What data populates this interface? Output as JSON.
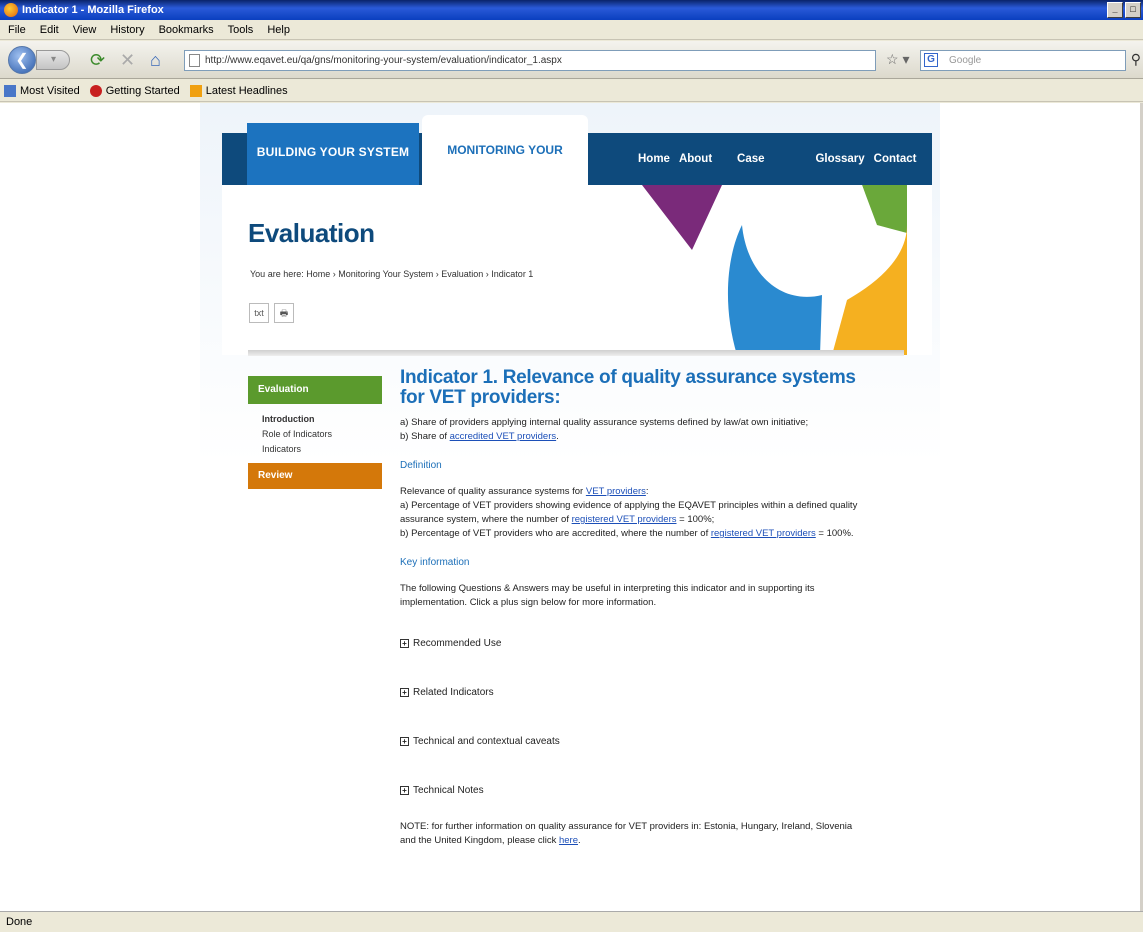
{
  "browser": {
    "title": "Indicator 1 - Mozilla Firefox",
    "window_controls": [
      "_",
      "□"
    ],
    "menu": [
      "File",
      "Edit",
      "View",
      "History",
      "Bookmarks",
      "Tools",
      "Help"
    ],
    "url": "http://www.eqavet.eu/qa/gns/monitoring-your-system/evaluation/indicator_1.aspx",
    "search_placeholder": "Google",
    "search_engine_icon": "G",
    "bookmarks": [
      {
        "label": "Most Visited",
        "icon": "page-icon",
        "color": "#4a78c8"
      },
      {
        "label": "Getting Started",
        "icon": "firefox-icon",
        "color": "#c82020"
      },
      {
        "label": "Latest Headlines",
        "icon": "rss-icon",
        "color": "#f0a010"
      }
    ],
    "status": "Done"
  },
  "site": {
    "tab_building": "BUILDING YOUR SYSTEM",
    "tab_monitoring": "MONITORING YOUR SYSTEM",
    "top_links": [
      "Home",
      "About Us",
      "Case Studies",
      "Glossary",
      "Contact Us"
    ],
    "page_title": "Evaluation",
    "breadcrumb": "You are here: Home › Monitoring Your System › Evaluation › Indicator 1",
    "tools": [
      "txt",
      "🖶"
    ],
    "colors": {
      "navy": "#0e4a7c",
      "blue": "#1c73bf",
      "green": "#5b9a2d",
      "orange": "#d4780a",
      "purple": "#7a2a7a",
      "yellow": "#f5b020"
    }
  },
  "sidenav": {
    "heading": "Evaluation",
    "items": [
      "Introduction",
      "Role of Indicators",
      "Indicators"
    ],
    "orange_item": "Review"
  },
  "main": {
    "title": "Indicator 1. Relevance of quality assurance systems for VET providers:",
    "intro_a": "a) Share of providers applying internal quality assurance systems defined by law/at own initiative;",
    "intro_b_prefix": "b) Share of ",
    "intro_b_link": "accredited VET providers",
    "intro_b_suffix": ".",
    "definition_head": "Definition",
    "def_line1_prefix": "Relevance of quality assurance systems for ",
    "def_line1_link": "VET providers",
    "def_line1_suffix": ":",
    "def_a_prefix": "a) Percentage of VET providers showing evidence of applying the EQAVET principles within a defined quality assurance system, where the number of ",
    "def_a_link": "registered VET providers",
    "def_a_suffix": " = 100%;",
    "def_b_prefix": "b) Percentage of VET providers who are accredited, where the number of ",
    "def_b_link": "registered VET providers",
    "def_b_suffix": " = 100%.",
    "key_head": "Key information",
    "key_text": "The following Questions & Answers may be useful in interpreting this indicator and in supporting its implementation. Click a plus sign below for more information.",
    "expanders": [
      "Recommended Use",
      "Related Indicators",
      "Technical and contextual caveats",
      "Technical Notes"
    ],
    "note_prefix": "NOTE: for further information on quality assurance for VET providers in: Estonia, Hungary, Ireland, Slovenia and the United Kingdom, please click ",
    "note_link": "here",
    "note_suffix": "."
  }
}
